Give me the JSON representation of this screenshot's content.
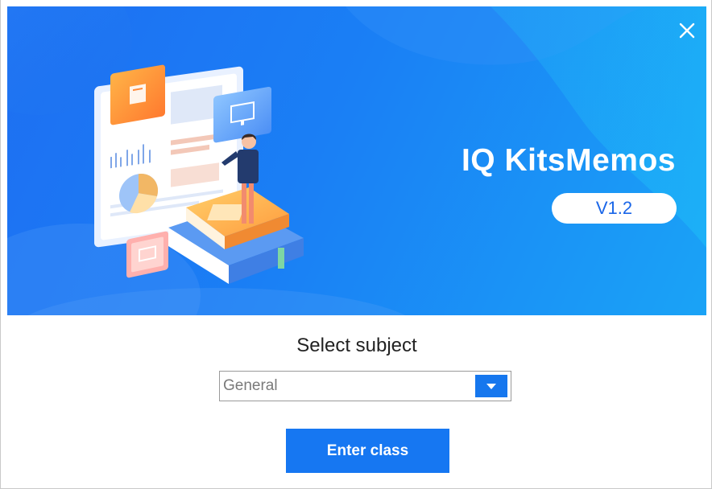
{
  "banner": {
    "app_title": "IQ KitsMemos",
    "version": "V1.2",
    "close_icon": "close-icon",
    "illustration": "teacher-presentation-illustration",
    "colors": {
      "gradient_start": "#1e6ff2",
      "gradient_end": "#1aa3f6"
    }
  },
  "form": {
    "label": "Select subject",
    "selected_subject": "General",
    "dropdown_icon": "chevron-down-icon",
    "enter_button": "Enter class"
  },
  "colors": {
    "accent": "#1677f2"
  }
}
